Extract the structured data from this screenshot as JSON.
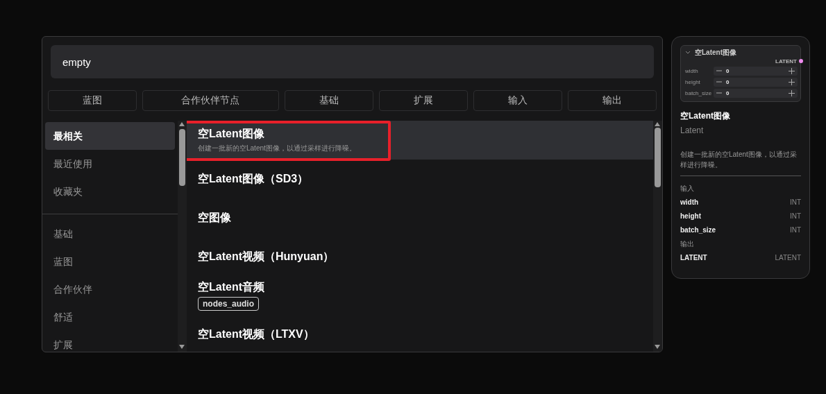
{
  "search": {
    "value": "empty"
  },
  "filters": [
    {
      "label": "蓝图"
    },
    {
      "label": "合作伙伴节点"
    },
    {
      "label": "基础"
    },
    {
      "label": "扩展"
    },
    {
      "label": "输入"
    },
    {
      "label": "输出"
    }
  ],
  "sidebar": {
    "groups": [
      [
        {
          "label": "最相关",
          "selected": true
        },
        {
          "label": "最近使用",
          "selected": false
        },
        {
          "label": "收藏夹",
          "selected": false
        }
      ],
      [
        {
          "label": "基础",
          "selected": false
        },
        {
          "label": "蓝图",
          "selected": false
        },
        {
          "label": "合作伙伴",
          "selected": false
        },
        {
          "label": "舒适",
          "selected": false
        },
        {
          "label": "扩展",
          "selected": false
        }
      ]
    ]
  },
  "results": [
    {
      "title": "空Latent图像",
      "description": "创建一批新的空Latent图像，以通过采样进行降噪。",
      "selected": true,
      "outlined": true
    },
    {
      "title": "空Latent图像（SD3）",
      "selected": false,
      "outlined": false
    },
    {
      "title": "空图像",
      "selected": false,
      "outlined": false
    },
    {
      "title": "空Latent视频（Hunyuan）",
      "selected": false,
      "outlined": false
    },
    {
      "title": "空Latent音频",
      "tag": "nodes_audio",
      "selected": false,
      "outlined": false
    },
    {
      "title": "空Latent视频（LTXV）",
      "selected": false,
      "outlined": false
    }
  ],
  "preview": {
    "node": {
      "title": "空Latent图像",
      "output": "LATENT",
      "widgets": [
        {
          "name": "width",
          "value": "0"
        },
        {
          "name": "height",
          "value": "0"
        },
        {
          "name": "batch_size",
          "value": "0"
        }
      ]
    },
    "title": "空Latent图像",
    "category": "Latent",
    "description": "创建一批新的空Latent图像，以通过采样进行降噪。",
    "inputs_label": "输入",
    "inputs": [
      {
        "name": "width",
        "type": "INT"
      },
      {
        "name": "height",
        "type": "INT"
      },
      {
        "name": "batch_size",
        "type": "INT"
      }
    ],
    "outputs_label": "输出",
    "outputs": [
      {
        "name": "LATENT",
        "type": "LATENT"
      }
    ]
  }
}
